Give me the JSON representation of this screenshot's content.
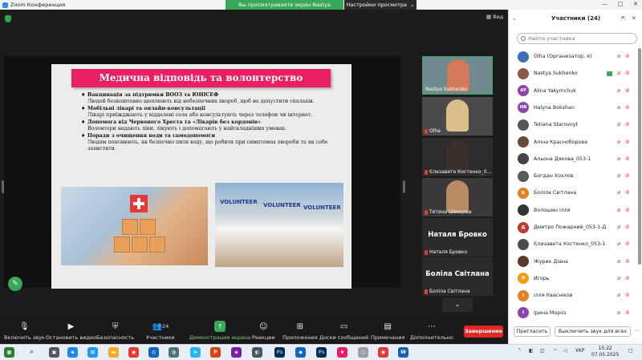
{
  "window": {
    "title": "Zoom Конференция",
    "share_banner": "Вы просматриваете экран Nastya Sukhenko",
    "share_settings": "Настройки просмотра"
  },
  "main": {
    "view_label": "Вид"
  },
  "slide": {
    "title": "Медична відповідь та волонтерство",
    "bullets": [
      {
        "head": "Вакцинація за підтримки ВООЗ та ЮНІСЕФ",
        "text": "Людей безкоштовно щеплюють від небезпечних хвороб, щоб не допустити спалахів."
      },
      {
        "head": "Мобільні лікарі та онлайн-консультації",
        "text": "Лікарі приїжджають у віддалені села або консультують через телефон чи інтернет."
      },
      {
        "head": "Допомога від Червоного Хреста та «Лікарів без кордонів»",
        "text": "Волонтери надають ліки, лікують і допомагають у найскладніших умовах."
      },
      {
        "head": "Поради з очищення води та самодопомоги",
        "text": "Людям пояснюють, як безпечно пити воду, що робити при симптомах хвороби та як себе захистити."
      }
    ],
    "volunteer_shirts": [
      "VOLUNTEER",
      "VOLUNTEER",
      "VOLUNTEER"
    ]
  },
  "gallery": [
    {
      "name": "Nastya Sukhenko",
      "type": "video"
    },
    {
      "name": "Olha",
      "type": "video"
    },
    {
      "name": "Єлизавета Костенко_0...",
      "type": "video"
    },
    {
      "name": "Тетяна Швецова",
      "type": "video"
    },
    {
      "name": "Наталя Бровко",
      "type": "name",
      "bigname": "Наталя Бровко"
    },
    {
      "name": "Боліла Світлана",
      "type": "name",
      "bigname": "Боліла Світлана"
    }
  ],
  "toolbar": {
    "unmute": "Включить звук",
    "stop_video": "Остановить видео",
    "security": "Безопасность",
    "participants": "Участники",
    "participants_count": "24",
    "share_screen": "Демонстрация экрана",
    "reactions": "Реакции",
    "apps": "Приложения",
    "whiteboards": "Доски сообщений",
    "notes": "Примечания",
    "more": "Дополнительно",
    "end": "Завершение"
  },
  "panel": {
    "title": "Участники (24)",
    "search_placeholder": "Найти участника",
    "participants": [
      {
        "name": "Olha (Организатор, я)",
        "initials": "",
        "color": "#3b6fb6",
        "video": false
      },
      {
        "name": "Nastya Sukhenko",
        "initials": "",
        "color": "#8a5a44",
        "video": true
      },
      {
        "name": "Alina Yakymchuk",
        "initials": "AY",
        "color": "#8e44ad",
        "video": false
      },
      {
        "name": "Halyna Bokshan",
        "initials": "HB",
        "color": "#8e44ad",
        "video": false
      },
      {
        "name": "Tetiana Starovoyt",
        "initials": "",
        "color": "#555555",
        "video": false
      },
      {
        "name": "Аліна Красноборова",
        "initials": "",
        "color": "#6b4a3a",
        "video": false
      },
      {
        "name": "Альона Дякова_053-1",
        "initials": "",
        "color": "#444444",
        "video": false
      },
      {
        "name": "Богдан Хохлов",
        "initials": "",
        "color": "#5a5a5a",
        "video": false
      },
      {
        "name": "Боліла Світлана",
        "initials": "Б",
        "color": "#e67e22",
        "video": false
      },
      {
        "name": "Волошин Ілля",
        "initials": "",
        "color": "#333333",
        "video": false
      },
      {
        "name": "Дмитро Пожарний_053-1-Д",
        "initials": "Д",
        "color": "#c0392b",
        "video": false
      },
      {
        "name": "Єлизавета Костенко_053-1",
        "initials": "",
        "color": "#4a4a4a",
        "video": false
      },
      {
        "name": "Журик Діана",
        "initials": "",
        "color": "#5b3a29",
        "video": false
      },
      {
        "name": "Игорь",
        "initials": "И",
        "color": "#f39c12",
        "video": false
      },
      {
        "name": "Ілля Квасніков",
        "initials": "І",
        "color": "#e67e22",
        "video": false
      },
      {
        "name": "Ірина Мороз",
        "initials": "І",
        "color": "#8e44ad",
        "video": false
      }
    ],
    "invite": "Пригласить",
    "mute_all": "Выключить звук для всех"
  },
  "taskbar": {
    "lang": "УКР",
    "time": "15:22",
    "date": "07.05.2025"
  }
}
